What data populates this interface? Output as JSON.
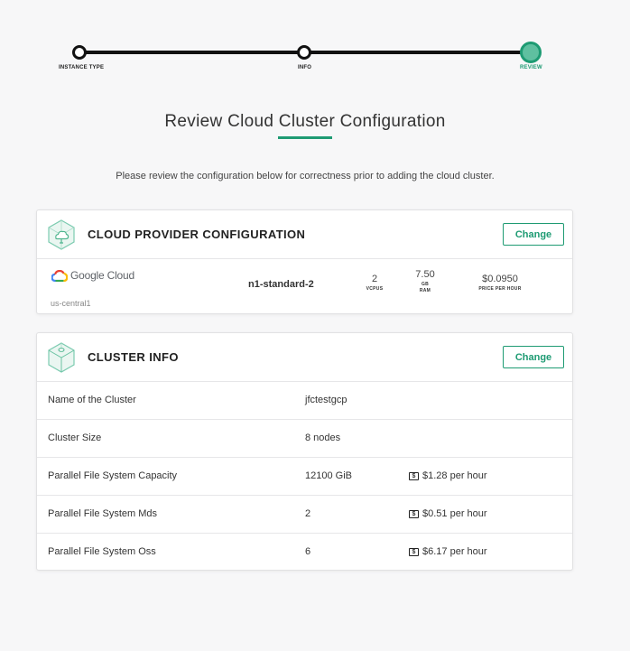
{
  "stepper": {
    "steps": [
      {
        "label": "INSTANCE TYPE"
      },
      {
        "label": "INFO"
      },
      {
        "label": "REVIEW"
      }
    ],
    "active_color": "#1e9b73"
  },
  "page": {
    "title": "Review Cloud Cluster Configuration",
    "subtitle": "Please review the configuration below for correctness prior to adding the cloud cluster."
  },
  "provider_card": {
    "icon": "cloud-box-icon",
    "title": "CLOUD PROVIDER CONFIGURATION",
    "change_label": "Change",
    "provider_name": "Google Cloud",
    "region": "us-central1",
    "machine_type": "n1-standard-2",
    "vcpus": {
      "value": "2",
      "unit": "VCPUS"
    },
    "ram": {
      "value": "7.50",
      "unit1": "GB",
      "unit2": "RAM"
    },
    "price": {
      "value": "$0.0950",
      "unit": "PRICE PER HOUR"
    }
  },
  "cluster_card": {
    "icon": "cluster-box-icon",
    "title": "CLUSTER INFO",
    "change_label": "Change",
    "rows": [
      {
        "label": "Name of the Cluster",
        "value": "jfctestgcp",
        "price": ""
      },
      {
        "label": "Cluster Size",
        "value": "8 nodes",
        "price": ""
      },
      {
        "label": "Parallel File System Capacity",
        "value": "12100 GiB",
        "price": "$1.28 per hour"
      },
      {
        "label": "Parallel File System Mds",
        "value": "2",
        "price": "$0.51 per hour"
      },
      {
        "label": "Parallel File System Oss",
        "value": "6",
        "price": "$6.17 per hour"
      }
    ]
  },
  "colors": {
    "accent": "#1e9b73",
    "background": "#f7f7f8"
  }
}
